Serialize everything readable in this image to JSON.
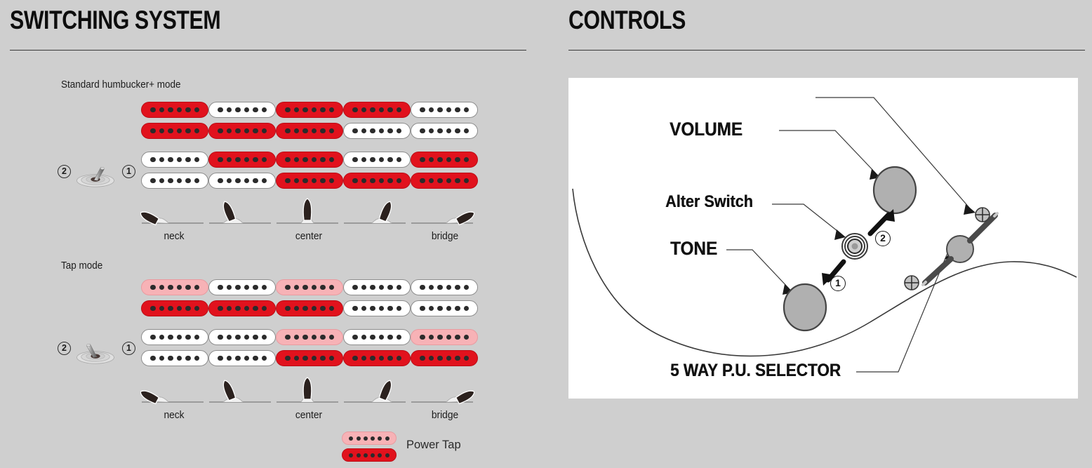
{
  "background_color": "#cfcfcf",
  "panels": {
    "switching": {
      "title": "SWITCHING SYSTEM",
      "modes": [
        {
          "id": "standard",
          "label": "Standard humbucker+ mode",
          "switch": {
            "left_number": "2",
            "right_number": "1",
            "lever_direction": "right"
          },
          "columns": [
            {
              "position": "neck",
              "label": "neck",
              "blade_angle": -62,
              "top_humbucker": [
                "red",
                "red"
              ],
              "bottom_humbucker": [
                "white",
                "white"
              ]
            },
            {
              "position": "neck-center",
              "label": "",
              "blade_angle": -28,
              "top_humbucker": [
                "white",
                "red"
              ],
              "bottom_humbucker": [
                "red",
                "white"
              ]
            },
            {
              "position": "center",
              "label": "center",
              "blade_angle": 0,
              "top_humbucker": [
                "red",
                "red"
              ],
              "bottom_humbucker": [
                "red",
                "red"
              ]
            },
            {
              "position": "center-bridge",
              "label": "",
              "blade_angle": 28,
              "top_humbucker": [
                "red",
                "white"
              ],
              "bottom_humbucker": [
                "white",
                "red"
              ]
            },
            {
              "position": "bridge",
              "label": "bridge",
              "blade_angle": 62,
              "top_humbucker": [
                "white",
                "white"
              ],
              "bottom_humbucker": [
                "red",
                "red"
              ]
            }
          ]
        },
        {
          "id": "tap",
          "label": "Tap mode",
          "switch": {
            "left_number": "2",
            "right_number": "1",
            "lever_direction": "left"
          },
          "columns": [
            {
              "position": "neck",
              "label": "neck",
              "blade_angle": -62,
              "top_humbucker": [
                "pink",
                "red"
              ],
              "bottom_humbucker": [
                "white",
                "white"
              ]
            },
            {
              "position": "neck-center",
              "label": "",
              "blade_angle": -28,
              "top_humbucker": [
                "white",
                "red"
              ],
              "bottom_humbucker": [
                "white",
                "white"
              ]
            },
            {
              "position": "center",
              "label": "center",
              "blade_angle": 0,
              "top_humbucker": [
                "pink",
                "red"
              ],
              "bottom_humbucker": [
                "pink",
                "red"
              ]
            },
            {
              "position": "center-bridge",
              "label": "",
              "blade_angle": 28,
              "top_humbucker": [
                "white",
                "white"
              ],
              "bottom_humbucker": [
                "white",
                "red"
              ]
            },
            {
              "position": "bridge",
              "label": "bridge",
              "blade_angle": 62,
              "top_humbucker": [
                "white",
                "white"
              ],
              "bottom_humbucker": [
                "pink",
                "red"
              ]
            }
          ]
        }
      ],
      "legend": {
        "swatch": [
          "pink",
          "red"
        ],
        "text": "Power Tap"
      }
    },
    "controls": {
      "title": "CONTROLS",
      "labels": [
        {
          "id": "volume",
          "text": "VOLUME"
        },
        {
          "id": "alter",
          "text": "Alter Switch"
        },
        {
          "id": "tone",
          "text": "TONE"
        },
        {
          "id": "selector",
          "text": "5 WAY P.U. SELECTOR"
        }
      ],
      "callout_numbers": [
        {
          "id": "alter-pos-2",
          "text": "2"
        },
        {
          "id": "alter-pos-1",
          "text": "1"
        }
      ]
    }
  },
  "colors": {
    "coil_red": "#e1121d",
    "coil_pink": "#f7b2b6",
    "coil_white": "#ffffff",
    "pole_piece": "#2b2b2b",
    "rule": "#3a3a3a",
    "knob_fill": "#b0b0b0"
  }
}
